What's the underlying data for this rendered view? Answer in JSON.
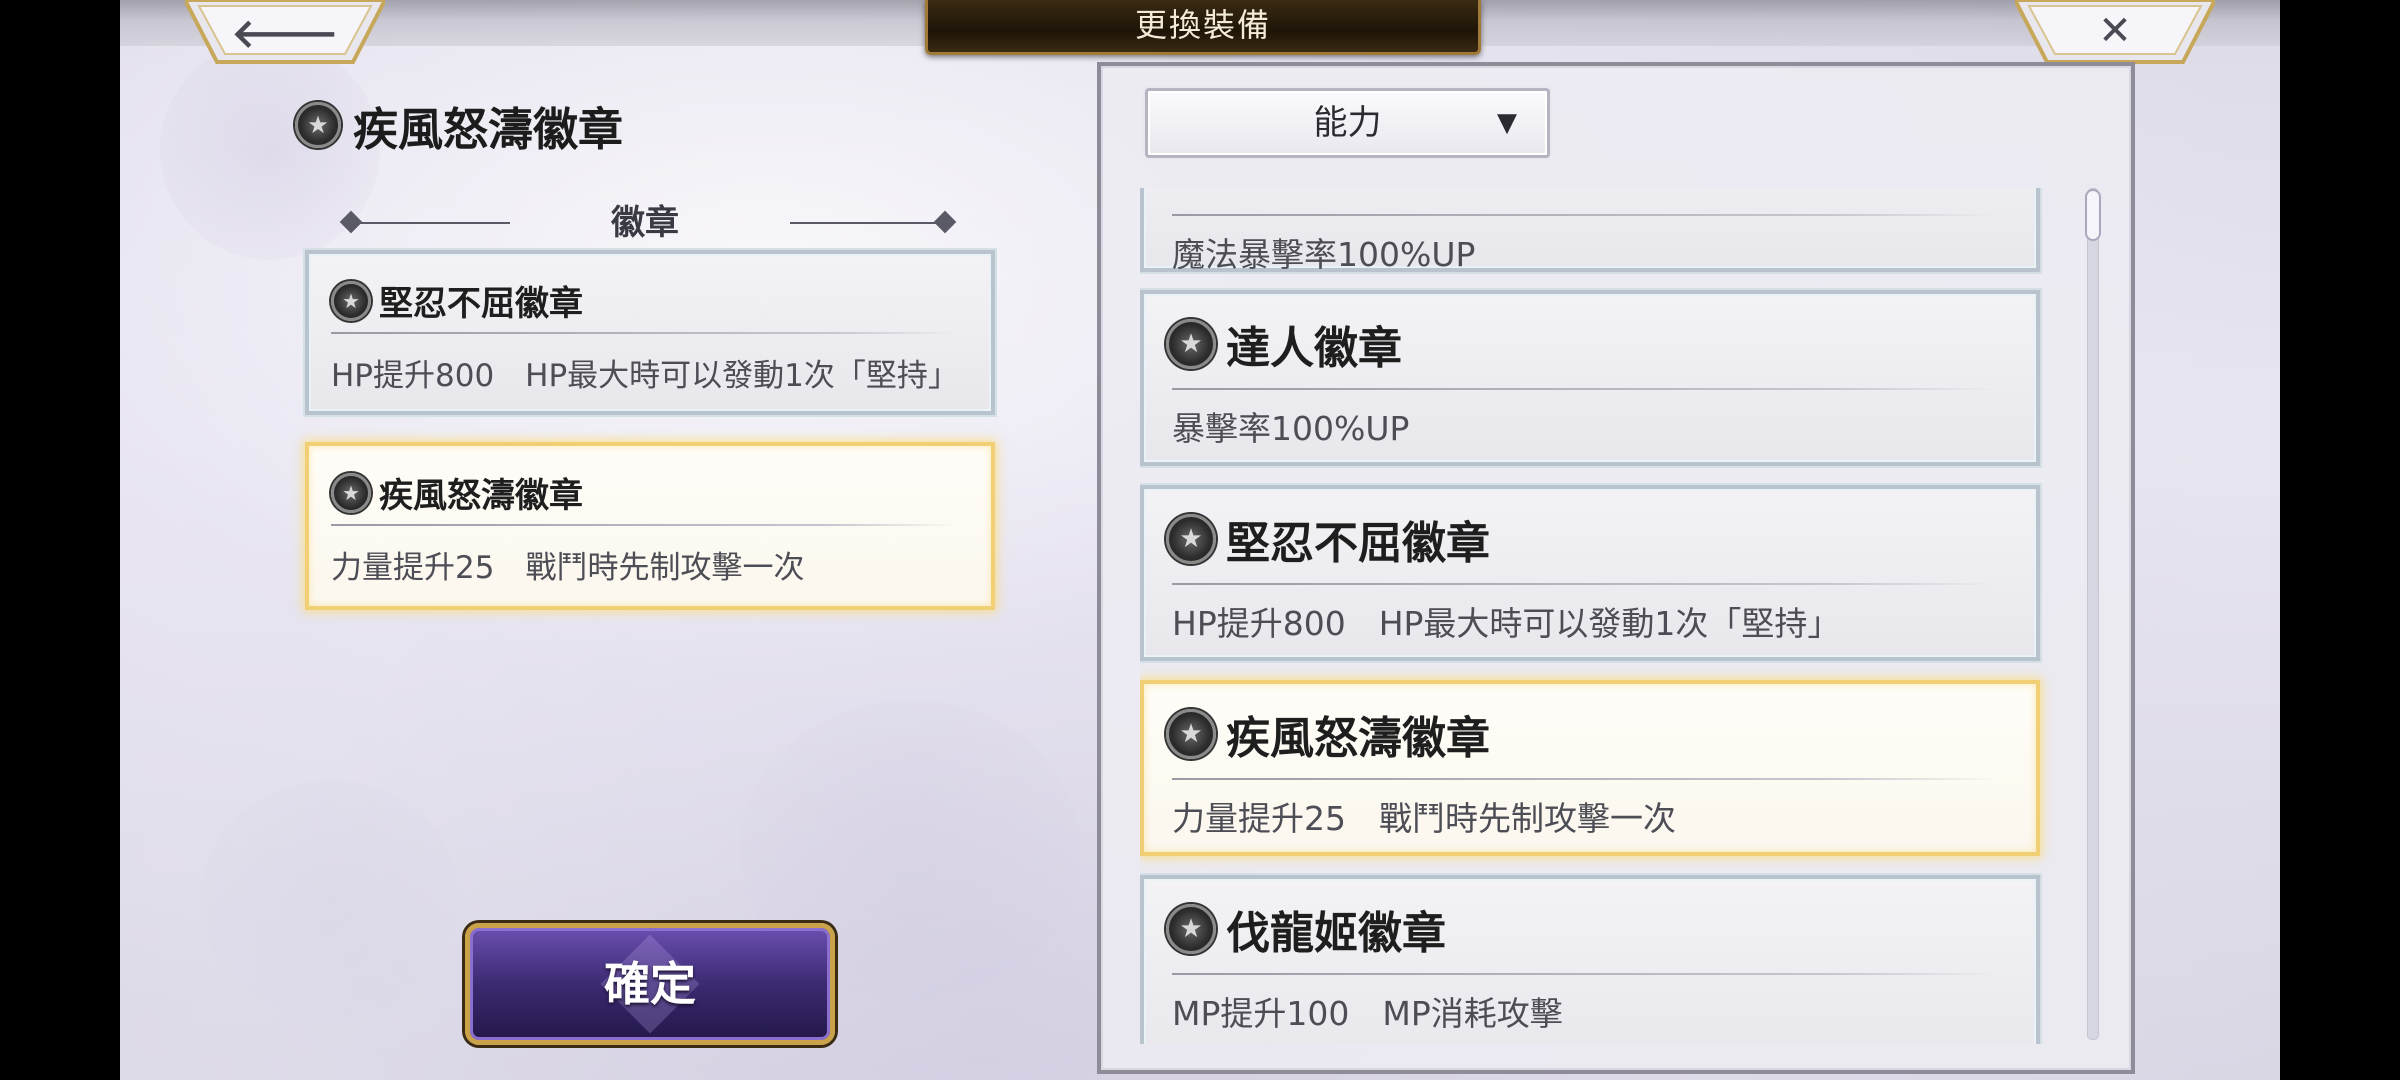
{
  "header": {
    "title": "更換裝備",
    "back_icon": "arrow-left-icon",
    "close_icon": "close-x-icon"
  },
  "current_item": {
    "icon": "star-emblem-icon",
    "title": "疾風怒濤徽章"
  },
  "section": {
    "label": "徽章"
  },
  "equipped": [
    {
      "icon": "star-emblem-icon",
      "name": "堅忍不屈徽章",
      "desc": "HP提升800　HP最大時可以發動1次「堅持」",
      "selected": false
    },
    {
      "icon": "star-emblem-icon",
      "name": "疾風怒濤徽章",
      "desc": "力量提升25　戰鬥時先制攻擊一次",
      "selected": true
    }
  ],
  "confirm_label": "確定",
  "filter": {
    "label": "能力",
    "caret": "▼"
  },
  "list": [
    {
      "icon": "star-emblem-icon",
      "name": "",
      "desc": "魔法暴擊率100%UP",
      "selected": false,
      "partial": true
    },
    {
      "icon": "star-emblem-icon",
      "name": "達人徽章",
      "desc": "暴擊率100%UP",
      "selected": false
    },
    {
      "icon": "star-emblem-icon",
      "name": "堅忍不屈徽章",
      "desc": "HP提升800　HP最大時可以發動1次「堅持」",
      "selected": false
    },
    {
      "icon": "star-emblem-icon",
      "name": "疾風怒濤徽章",
      "desc": "力量提升25　戰鬥時先制攻擊一次",
      "selected": true
    },
    {
      "icon": "star-emblem-icon",
      "name": "伐龍姬徽章",
      "desc": "MP提升100　MP消耗攻擊",
      "selected": false
    }
  ],
  "colors": {
    "selected_border": "#f1cf75",
    "card_border": "#b9c3cd",
    "title_plate": "#1e1508",
    "confirm_bg": "#3c2a72",
    "gold_trim": "#c9a24a"
  }
}
